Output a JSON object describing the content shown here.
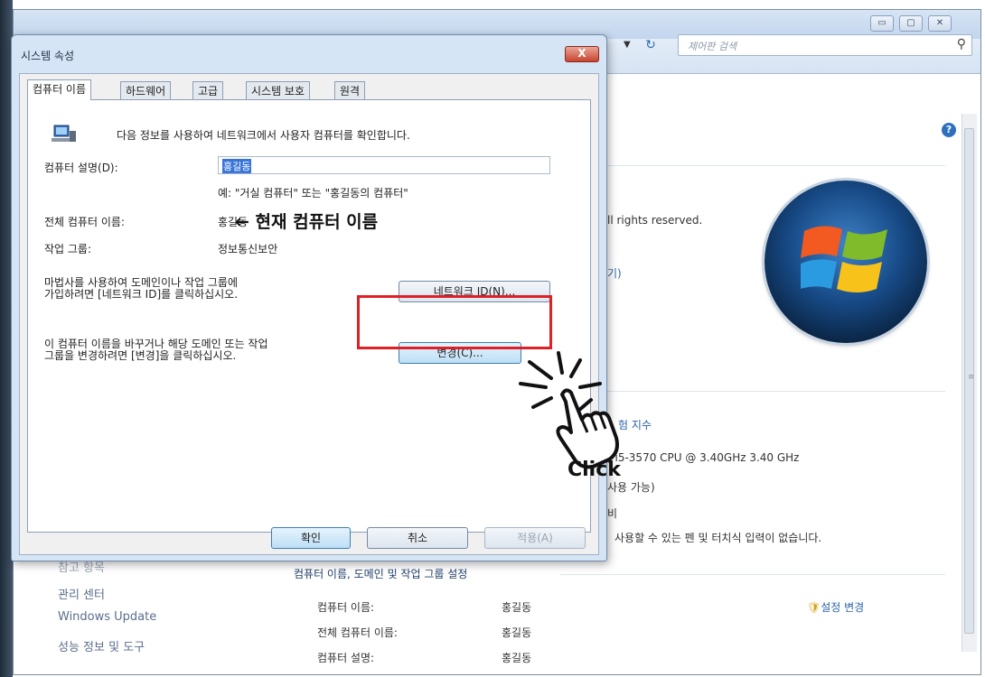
{
  "background_window": {
    "search_placeholder": "제어판 검색",
    "help_icon": "?",
    "rights_text": "ll rights reserved.",
    "link_fragment": "기)",
    "rating_label": "험 지수",
    "cpu_text": ") i5-3570 CPU @ 3.40GHz   3.40 GHz",
    "ram_text": "사용 가능)",
    "system_type_fragment": "비",
    "pen_text": "사용할 수 있는 펜 및 터치식 입력이 없습니다.",
    "section_title": "컴퓨터 이름, 도메인 및 작업 그룹 설정",
    "rows": [
      {
        "label": "컴퓨터 이름:",
        "value": "홍길동"
      },
      {
        "label": "전체 컴퓨터 이름:",
        "value": "홍길동"
      },
      {
        "label": "컴퓨터 설명:",
        "value": "홍길동"
      }
    ],
    "change_settings_link": "설정 변경",
    "left_links": [
      "관리 센터",
      "Windows Update",
      "성능 정보 및 도구"
    ],
    "left_partial": "참고 항목"
  },
  "dialog": {
    "title": "시스템 속성",
    "close_label": "X",
    "tabs": [
      {
        "label": "컴퓨터 이름",
        "active": true
      },
      {
        "label": "하드웨어"
      },
      {
        "label": "고급"
      },
      {
        "label": "시스템 보호"
      },
      {
        "label": "원격"
      }
    ],
    "intro": "다음 정보를 사용하여 네트워크에서 사용자 컴퓨터를 확인합니다.",
    "description_label": "컴퓨터 설명(D):",
    "description_value": "홍길동",
    "description_example": "예: \"거실 컴퓨터\" 또는 \"홍길동의 컴퓨터\"",
    "full_name_label": "전체 컴퓨터 이름:",
    "full_name_value": "홍길동",
    "workgroup_label": "작업 그룹:",
    "workgroup_value": "정보통신보안",
    "wizard_text_line1": "마법사를 사용하여 도메인이나 작업 그룹에",
    "wizard_text_line2": "가입하려면 [네트워크 ID]를 클릭하십시오.",
    "network_id_button": "네트워크 ID(N)...",
    "rename_text_line1": "이 컴퓨터 이름을 바꾸거나 해당 도메인 또는 작업",
    "rename_text_line2": "그룹을 변경하려면 [변경]을 클릭하십시오.",
    "change_button": "변경(C)...",
    "ok_button": "확인",
    "cancel_button": "취소",
    "apply_button": "적용(A)"
  },
  "annotations": {
    "current_name_arrow": "← 현재 컴퓨터 이름",
    "click_label": "Click"
  }
}
